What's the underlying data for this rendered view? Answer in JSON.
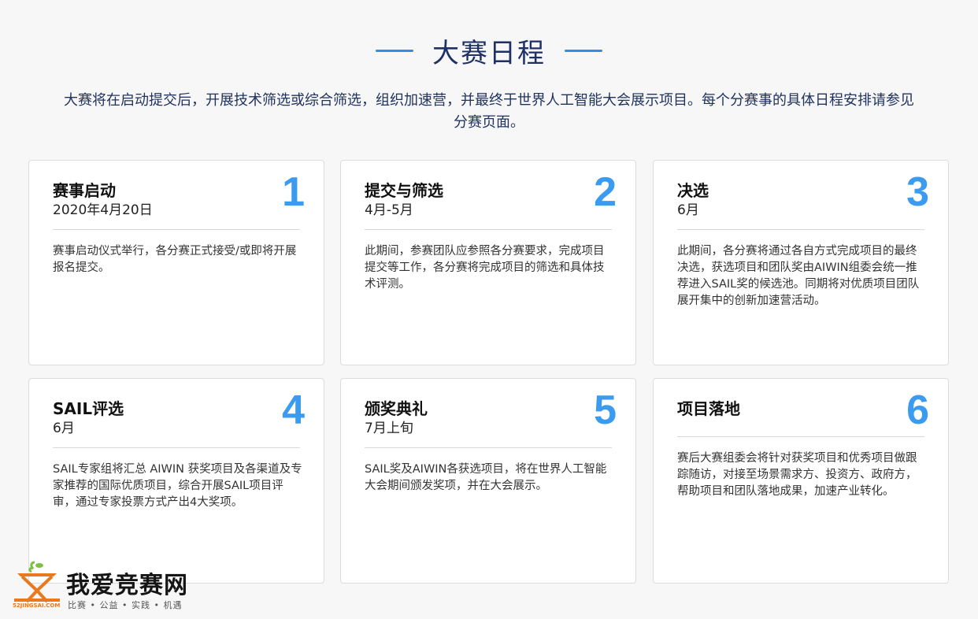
{
  "header": {
    "title": "大赛日程",
    "intro": "大赛将在启动提交后，开展技术筛选或综合筛选，组织加速营，并最终于世界人工智能大会展示项目。每个分赛事的具体日程安排请参见分赛页面。"
  },
  "cards": [
    {
      "num": "1",
      "title": "赛事启动",
      "date": "2020年4月20日",
      "desc": "赛事启动仪式举行，各分赛正式接受/或即将开展报名提交。"
    },
    {
      "num": "2",
      "title": "提交与筛选",
      "date": "4月-5月",
      "desc": "此期间，参赛团队应参照各分赛要求，完成项目提交等工作，各分赛将完成项目的筛选和具体技术评测。"
    },
    {
      "num": "3",
      "title": "决选",
      "date": "6月",
      "desc": "此期间，各分赛将通过各自方式完成项目的最终决选，获选项目和团队奖由AIWIN组委会统一推荐进入SAIL奖的候选池。同期将对优质项目团队展开集中的创新加速营活动。"
    },
    {
      "num": "4",
      "title": "SAIL评选",
      "date": "6月",
      "desc": "SAIL专家组将汇总 AIWIN 获奖项目及各渠道及专家推荐的国际优质项目，综合开展SAIL项目评审，通过专家投票方式产出4大奖项。"
    },
    {
      "num": "5",
      "title": "颁奖典礼",
      "date": "7月上旬",
      "desc": "SAIL奖及AIWIN各获选项目，将在世界人工智能大会期间颁发奖项，并在大会展示。"
    },
    {
      "num": "6",
      "title": "项目落地",
      "date": "",
      "desc": "赛后大赛组委会将针对获奖项目和优秀项目做跟踪随访，对接至场景需求方、投资方、政府方，帮助项目和团队落地成果，加速产业转化。"
    }
  ],
  "watermark": {
    "name": "我爱竞赛网",
    "tagline": "比赛 • 公益 • 实践 • 机遇",
    "url": "52JINGSAI.COM"
  },
  "colors": {
    "accent": "#3a9bf0",
    "title": "#1e3066"
  }
}
